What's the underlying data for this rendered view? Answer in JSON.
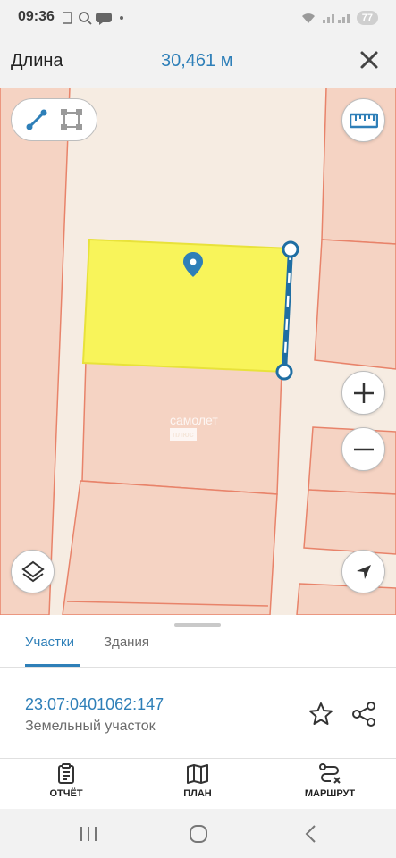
{
  "status_bar": {
    "time": "09:36",
    "battery": "77"
  },
  "measure": {
    "label": "Длина",
    "value": "30,461 м"
  },
  "map": {
    "watermark_line1": "самолет",
    "watermark_line2": "плюс",
    "colors": {
      "background": "#f6ece2",
      "parcel_border": "#e8836a",
      "selected_parcel": "#f8f45a",
      "measure_line": "#1f6ea3"
    },
    "icons": [
      "line-measure-icon",
      "area-measure-icon",
      "ruler-icon",
      "zoom-in-icon",
      "zoom-out-icon",
      "layers-icon",
      "locate-arrow-icon",
      "map-pin-icon"
    ]
  },
  "sheet": {
    "tabs": [
      {
        "label": "Участки",
        "active": true
      },
      {
        "label": "Здания",
        "active": false
      }
    ],
    "parcel": {
      "cadastral_number": "23:07:0401062:147",
      "type": "Земельный участок"
    },
    "actions": [
      {
        "label": "ОТЧЁТ",
        "icon": "report-icon"
      },
      {
        "label": "ПЛАН",
        "icon": "map-plan-icon"
      },
      {
        "label": "МАРШРУТ",
        "icon": "route-icon"
      }
    ]
  },
  "accent_color": "#2e7fb8"
}
